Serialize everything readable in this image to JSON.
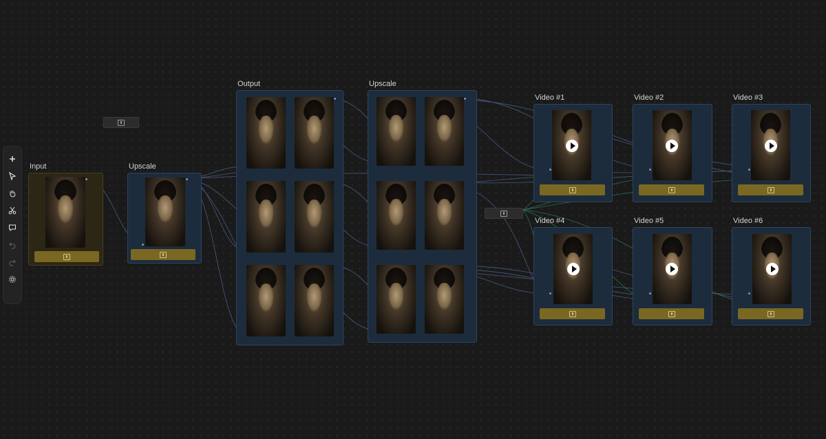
{
  "toolbar": {
    "tools": [
      {
        "name": "add-icon",
        "enabled": true
      },
      {
        "name": "pointer-icon",
        "enabled": true
      },
      {
        "name": "hand-icon",
        "enabled": true
      },
      {
        "name": "scissors-icon",
        "enabled": true
      },
      {
        "name": "comment-icon",
        "enabled": true
      },
      {
        "name": "undo-icon",
        "enabled": false
      },
      {
        "name": "redo-icon",
        "enabled": false
      },
      {
        "name": "settings-icon",
        "enabled": true
      }
    ]
  },
  "nodes": {
    "input": {
      "label": "Input"
    },
    "upscale_1": {
      "label": "Upscale"
    },
    "output": {
      "label": "Output"
    },
    "upscale_2": {
      "label": "Upscale"
    },
    "video_1": {
      "label": "Video #1"
    },
    "video_2": {
      "label": "Video #2"
    },
    "video_3": {
      "label": "Video #3"
    },
    "video_4": {
      "label": "Video #4"
    },
    "video_5": {
      "label": "Video #5"
    },
    "video_6": {
      "label": "Video #6"
    }
  },
  "colors": {
    "canvas": "#1a1a1a",
    "node_fill": "#1c2c3c",
    "node_border": "#2d4460",
    "input_node_fill": "#2c2614",
    "run_button": "#7a6722",
    "wire": "#4a5f88",
    "wire_accent": "#2f7a5e"
  }
}
